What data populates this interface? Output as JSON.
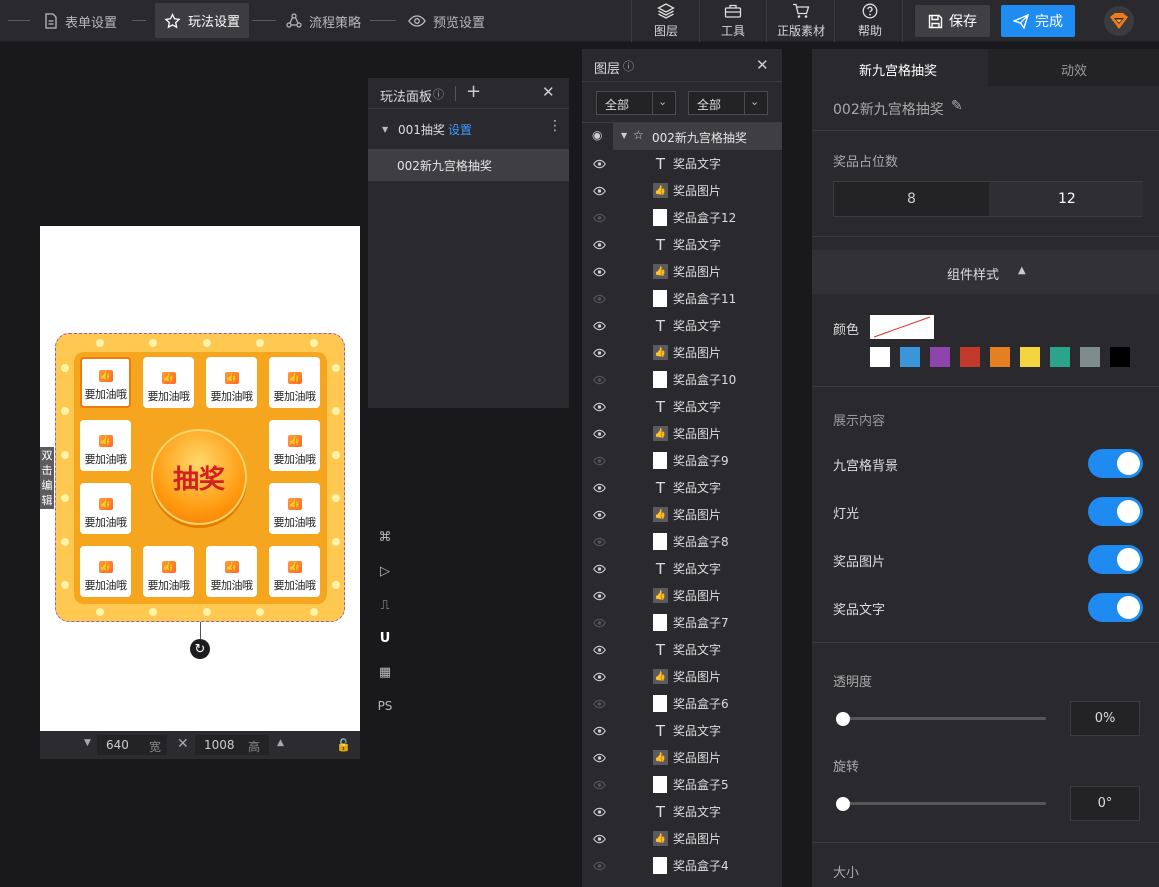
{
  "steps": [
    {
      "label": "表单设置",
      "icon": "document-icon"
    },
    {
      "label": "玩法设置",
      "icon": "star-icon"
    },
    {
      "label": "流程策略",
      "icon": "flow-icon"
    },
    {
      "label": "预览设置",
      "icon": "eye-icon"
    }
  ],
  "tools": [
    {
      "label": "图层",
      "icon": "layers-icon"
    },
    {
      "label": "工具",
      "icon": "toolbox-icon"
    },
    {
      "label": "正版素材",
      "icon": "cart-icon"
    },
    {
      "label": "帮助",
      "icon": "help-icon"
    }
  ],
  "actions": {
    "save": "保存",
    "done": "完成"
  },
  "canvas": {
    "edit_tag": "双击编辑",
    "prize_text": "要加油哦",
    "draw_button": "抽奖",
    "width_value": "640",
    "width_unit": "宽",
    "height_value": "1008",
    "height_unit": "高"
  },
  "vertical_tools": [
    {
      "icon": "command-icon",
      "glyph": "⌘"
    },
    {
      "icon": "play-icon",
      "glyph": "▷"
    },
    {
      "icon": "ruler-icon",
      "glyph": "⎍"
    },
    {
      "icon": "magnet-icon",
      "glyph": "U"
    },
    {
      "icon": "grid-icon",
      "glyph": "▦"
    },
    {
      "icon": "ps-icon",
      "glyph": "PS"
    }
  ],
  "play_panel": {
    "title": "玩法面板",
    "info_glyph": "ⓘ",
    "tree_item": "001抽奖",
    "tree_item_link": "设置",
    "selected_item": "002新九宫格抽奖"
  },
  "layers_panel": {
    "title": "图层",
    "info_glyph": "ⓘ",
    "filter1": "全部",
    "filter2": "全部",
    "root": "002新九宫格抽奖",
    "rows": [
      {
        "name": "奖品文字",
        "type": "text",
        "visible": true
      },
      {
        "name": "奖品图片",
        "type": "image",
        "visible": true
      },
      {
        "name": "奖品盒子12",
        "type": "box",
        "visible": false
      },
      {
        "name": "奖品文字",
        "type": "text",
        "visible": true
      },
      {
        "name": "奖品图片",
        "type": "image",
        "visible": true
      },
      {
        "name": "奖品盒子11",
        "type": "box",
        "visible": false
      },
      {
        "name": "奖品文字",
        "type": "text",
        "visible": true
      },
      {
        "name": "奖品图片",
        "type": "image",
        "visible": true
      },
      {
        "name": "奖品盒子10",
        "type": "box",
        "visible": false
      },
      {
        "name": "奖品文字",
        "type": "text",
        "visible": true
      },
      {
        "name": "奖品图片",
        "type": "image",
        "visible": true
      },
      {
        "name": "奖品盒子9",
        "type": "box",
        "visible": false
      },
      {
        "name": "奖品文字",
        "type": "text",
        "visible": true
      },
      {
        "name": "奖品图片",
        "type": "image",
        "visible": true
      },
      {
        "name": "奖品盒子8",
        "type": "box",
        "visible": false
      },
      {
        "name": "奖品文字",
        "type": "text",
        "visible": true
      },
      {
        "name": "奖品图片",
        "type": "image",
        "visible": true
      },
      {
        "name": "奖品盒子7",
        "type": "box",
        "visible": false
      },
      {
        "name": "奖品文字",
        "type": "text",
        "visible": true
      },
      {
        "name": "奖品图片",
        "type": "image",
        "visible": true
      },
      {
        "name": "奖品盒子6",
        "type": "box",
        "visible": false
      },
      {
        "name": "奖品文字",
        "type": "text",
        "visible": true
      },
      {
        "name": "奖品图片",
        "type": "image",
        "visible": true
      },
      {
        "name": "奖品盒子5",
        "type": "box",
        "visible": false
      },
      {
        "name": "奖品文字",
        "type": "text",
        "visible": true
      },
      {
        "name": "奖品图片",
        "type": "image",
        "visible": true
      },
      {
        "name": "奖品盒子4",
        "type": "box",
        "visible": false
      }
    ]
  },
  "props": {
    "tab_active": "新九宫格抽奖",
    "tab_other": "动效",
    "component_name": "002新九宫格抽奖",
    "prize_count_label": "奖品占位数",
    "prize_count_options": [
      "8",
      "12"
    ],
    "prize_count_selected": "12",
    "style_section": "组件样式",
    "color_label": "颜色",
    "swatches": [
      "#ffffff",
      "#3a96d8",
      "#8e44ad",
      "#c0392b",
      "#e67e22",
      "#f5d442",
      "#2aa58a",
      "#7f8c8d",
      "#000000"
    ],
    "display_section": "展示内容",
    "toggles": [
      {
        "label": "九宫格背景",
        "on": true
      },
      {
        "label": "灯光",
        "on": true
      },
      {
        "label": "奖品图片",
        "on": true
      },
      {
        "label": "奖品文字",
        "on": true
      }
    ],
    "opacity_label": "透明度",
    "opacity_value": "0%",
    "rotate_label": "旋转",
    "rotate_value": "0°",
    "size_label": "大小"
  }
}
